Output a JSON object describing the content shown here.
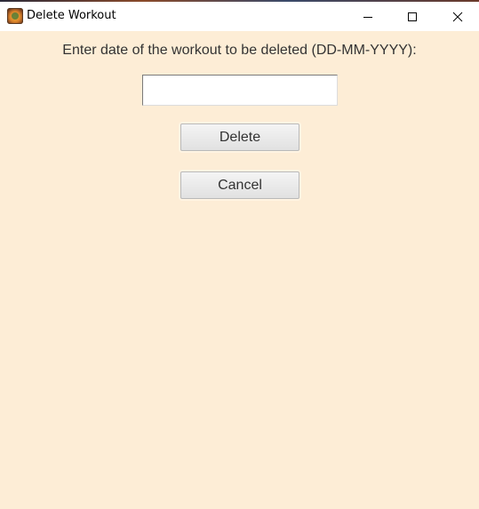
{
  "window": {
    "title": "Delete Workout",
    "app_icon": "workout-app-icon",
    "controls": {
      "minimize_icon": "minimize-icon",
      "maximize_icon": "maximize-icon",
      "close_icon": "close-icon"
    }
  },
  "form": {
    "prompt": "Enter date of the workout to be deleted (DD-MM-YYYY):",
    "date_value": "",
    "date_placeholder": "",
    "delete_label": "Delete",
    "cancel_label": "Cancel"
  },
  "colors": {
    "background": "#fdedd6",
    "titlebar": "#ffffff",
    "button_face": "#e9e9e9",
    "text": "#333333"
  }
}
